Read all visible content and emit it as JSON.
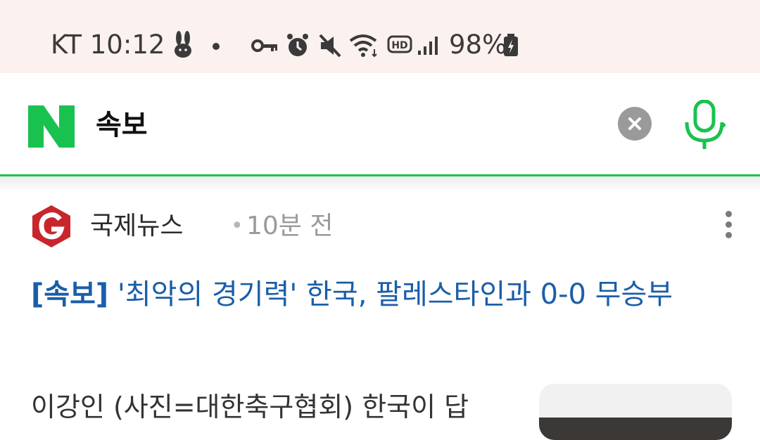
{
  "status_bar": {
    "carrier": "KT",
    "time": "10:12",
    "battery": "98%",
    "icons": [
      "rabbit-icon",
      "dot-icon",
      "vpn-key-icon",
      "alarm-icon",
      "mute-icon",
      "wifi-icon",
      "hd-icon",
      "signal-icon",
      "battery-charging-icon"
    ]
  },
  "search": {
    "query": "속보",
    "logo": "N",
    "clear_icon": "close-icon",
    "mic_icon": "microphone-icon",
    "colors": {
      "brand": "#19c24e",
      "clear_bg": "#9a9a9a"
    }
  },
  "article": {
    "source": "국제뉴스",
    "separator": "•",
    "time_ago": "10분 전",
    "headline_tag": "[속보]",
    "headline_rest": " '최악의 경기력' 한국, 팔레스타인과 0-0 무승부",
    "summary": "이강인 (사진=대한축구협회) 한국이 답",
    "colors": {
      "headline": "#1a5ea9",
      "source_logo": "#c8262c"
    }
  }
}
